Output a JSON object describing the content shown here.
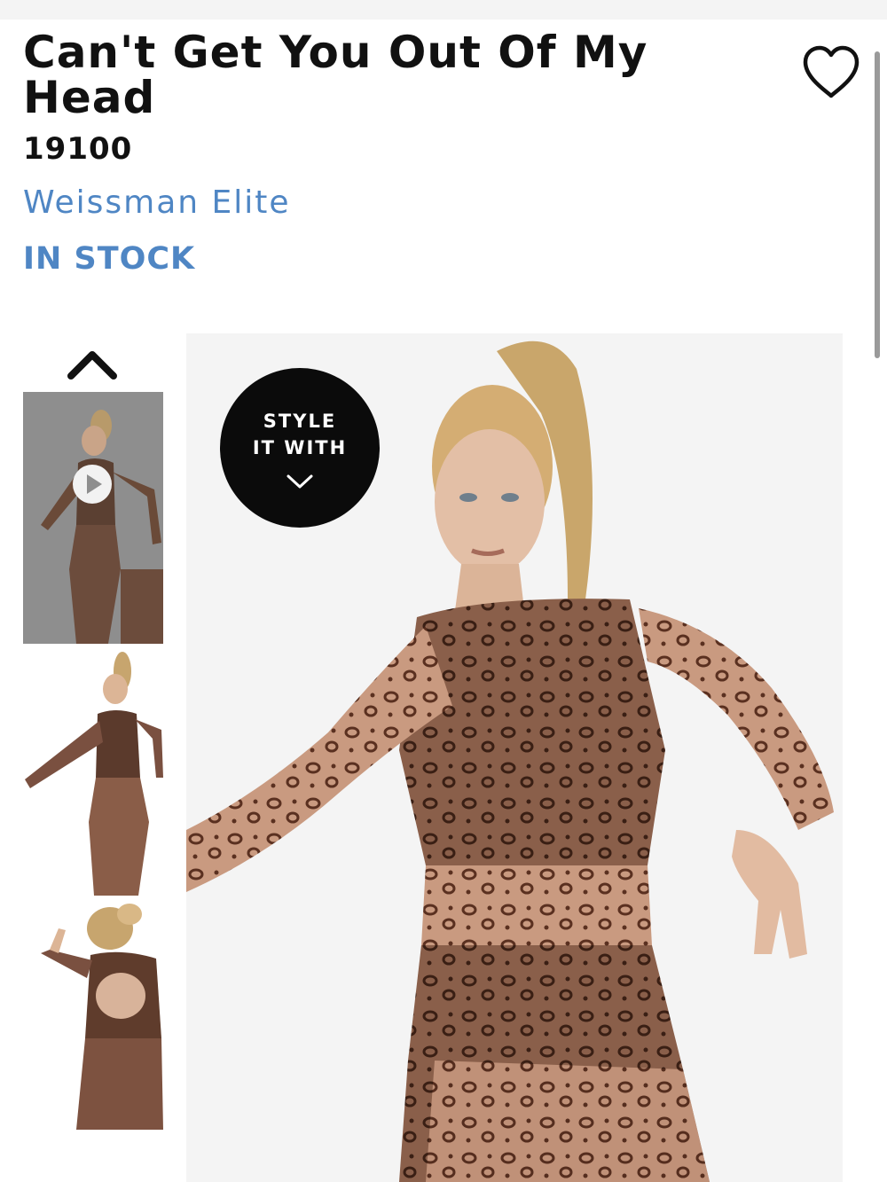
{
  "product": {
    "title": "Can't Get You Out Of My Head",
    "sku": "19100",
    "brand": "Weissman Elite",
    "stock_status": "IN STOCK"
  },
  "style_badge": {
    "line1": "STYLE",
    "line2": "IT WITH"
  },
  "gallery": {
    "thumbnails": [
      {
        "type": "video"
      },
      {
        "type": "image"
      },
      {
        "type": "image"
      }
    ]
  },
  "icons": {
    "favorite": "heart-outline-icon",
    "gallery_up": "chevron-up-icon",
    "badge_down": "chevron-down-icon",
    "video": "play-icon"
  },
  "colors": {
    "accent_blue": "#4f86c4",
    "badge_black": "#0b0b0b"
  }
}
